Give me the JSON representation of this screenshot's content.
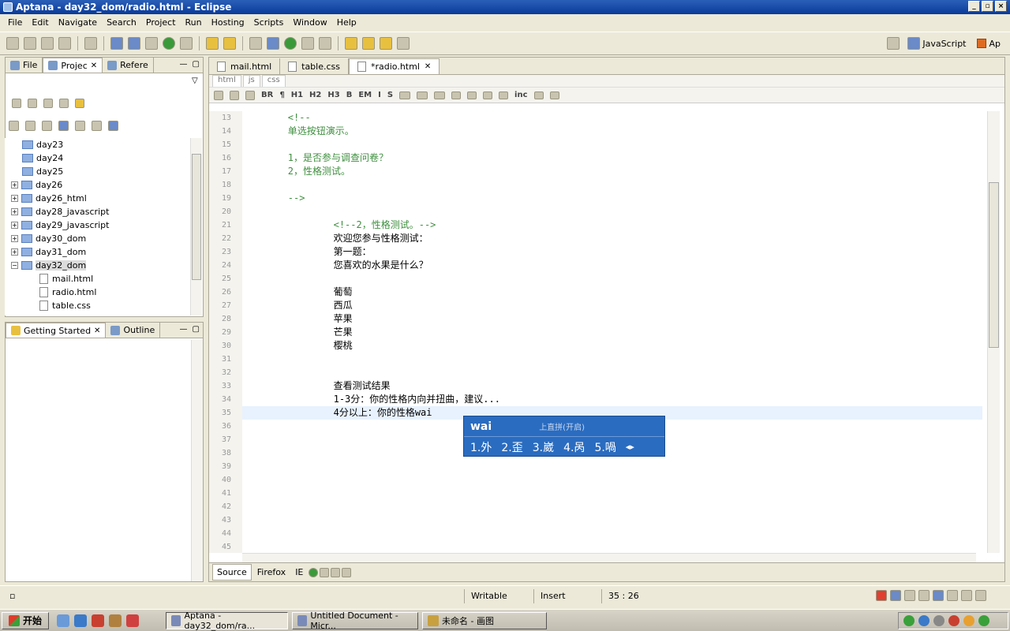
{
  "window": {
    "title": "Aptana - day32_dom/radio.html - Eclipse"
  },
  "menu": [
    "File",
    "Edit",
    "Navigate",
    "Search",
    "Project",
    "Run",
    "Hosting",
    "Scripts",
    "Window",
    "Help"
  ],
  "perspective": {
    "js_label": "JavaScript",
    "ap_label": "Ap"
  },
  "left_panel": {
    "tabs": [
      {
        "label": "File"
      },
      {
        "label": "Projec"
      },
      {
        "label": "Refere"
      }
    ],
    "tree": [
      {
        "label": "day23",
        "expander": "",
        "kind": "folder"
      },
      {
        "label": "day24",
        "expander": "",
        "kind": "folder"
      },
      {
        "label": "day25",
        "expander": "",
        "kind": "folder"
      },
      {
        "label": "day26",
        "expander": "+",
        "kind": "folder"
      },
      {
        "label": "day26_html",
        "expander": "+",
        "kind": "folder"
      },
      {
        "label": "day28_javascript",
        "expander": "+",
        "kind": "folder"
      },
      {
        "label": "day29_javascript",
        "expander": "+",
        "kind": "folder"
      },
      {
        "label": "day30_dom",
        "expander": "+",
        "kind": "folder"
      },
      {
        "label": "day31_dom",
        "expander": "+",
        "kind": "folder"
      },
      {
        "label": "day32_dom",
        "expander": "−",
        "kind": "folder"
      },
      {
        "label": "mail.html",
        "expander": "",
        "kind": "file"
      },
      {
        "label": "radio.html",
        "expander": "",
        "kind": "file"
      },
      {
        "label": "table.css",
        "expander": "",
        "kind": "file"
      }
    ]
  },
  "bottom_left_panel": {
    "tabs": [
      {
        "label": "Getting Started"
      },
      {
        "label": "Outline"
      }
    ]
  },
  "editor": {
    "tabs": [
      {
        "label": "mail.html"
      },
      {
        "label": "table.css"
      },
      {
        "label": "*radio.html"
      }
    ],
    "subtabs": [
      "html",
      "js",
      "css"
    ],
    "format_buttons": [
      "BR",
      "¶",
      "H1",
      "H2",
      "H3",
      "B",
      "EM",
      "I",
      "S",
      "inc"
    ],
    "line_numbers": [
      "13",
      "14",
      "15",
      "16",
      "17",
      "18",
      "19",
      "20",
      "21",
      "22",
      "23",
      "24",
      "25",
      "26",
      "27",
      "28",
      "29",
      "30",
      "31",
      "32",
      "33",
      "34",
      "35",
      "36",
      "37",
      "38",
      "39",
      "40",
      "41",
      "42",
      "43",
      "44",
      "45"
    ],
    "lines": [
      {
        "text": "        <!--",
        "style": "cmt"
      },
      {
        "text": "        单选按钮演示。",
        "style": "cmt"
      },
      {
        "text": "",
        "style": ""
      },
      {
        "text": "        1，是否参与调查问卷？",
        "style": "cmt"
      },
      {
        "text": "        2，性格测试。",
        "style": "cmt"
      },
      {
        "text": "",
        "style": ""
      },
      {
        "text": "        -->",
        "style": "cmt"
      },
      {
        "text": "",
        "style": ""
      },
      {
        "text": "                <!--2，性格测试。-->",
        "style": "cmt"
      },
      {
        "text": "                欢迎您参与性格测试：",
        "style": ""
      },
      {
        "text": "                第一题：",
        "style": ""
      },
      {
        "text": "                您喜欢的水果是什么？",
        "style": ""
      },
      {
        "text": "",
        "style": ""
      },
      {
        "text": "                葡萄",
        "style": ""
      },
      {
        "text": "                西瓜",
        "style": ""
      },
      {
        "text": "                苹果",
        "style": ""
      },
      {
        "text": "                芒果",
        "style": ""
      },
      {
        "text": "                樱桃",
        "style": ""
      },
      {
        "text": "",
        "style": ""
      },
      {
        "text": "",
        "style": ""
      },
      {
        "text": "                查看测试结果",
        "style": ""
      },
      {
        "text": "                1-3分：你的性格内向并扭曲，建议...",
        "style": ""
      },
      {
        "text": "                4分以上：你的性格wai",
        "style": "cur"
      },
      {
        "text": "",
        "style": ""
      },
      {
        "text": "",
        "style": ""
      },
      {
        "text": "",
        "style": ""
      },
      {
        "text": "",
        "style": ""
      },
      {
        "text": "",
        "style": ""
      },
      {
        "text": "",
        "style": ""
      },
      {
        "text": "",
        "style": ""
      },
      {
        "text": "",
        "style": ""
      },
      {
        "text": "",
        "style": ""
      },
      {
        "text": "",
        "style": ""
      }
    ],
    "bottom_tabs": [
      "Source",
      "Firefox",
      "IE"
    ]
  },
  "ime": {
    "composition": "wai",
    "hint": "上直拼(开启)",
    "candidates": [
      "1.外",
      "2.歪",
      "3.崴",
      "4.呙",
      "5.喎"
    ]
  },
  "status": {
    "writable": "Writable",
    "insert": "Insert",
    "position": "35 : 26"
  },
  "taskbar": {
    "start": "开始",
    "tasks": [
      {
        "label": "Aptana - day32_dom/ra..."
      },
      {
        "label": "Untitled Document - Micr..."
      },
      {
        "label": "未命名 - 画图"
      }
    ]
  }
}
